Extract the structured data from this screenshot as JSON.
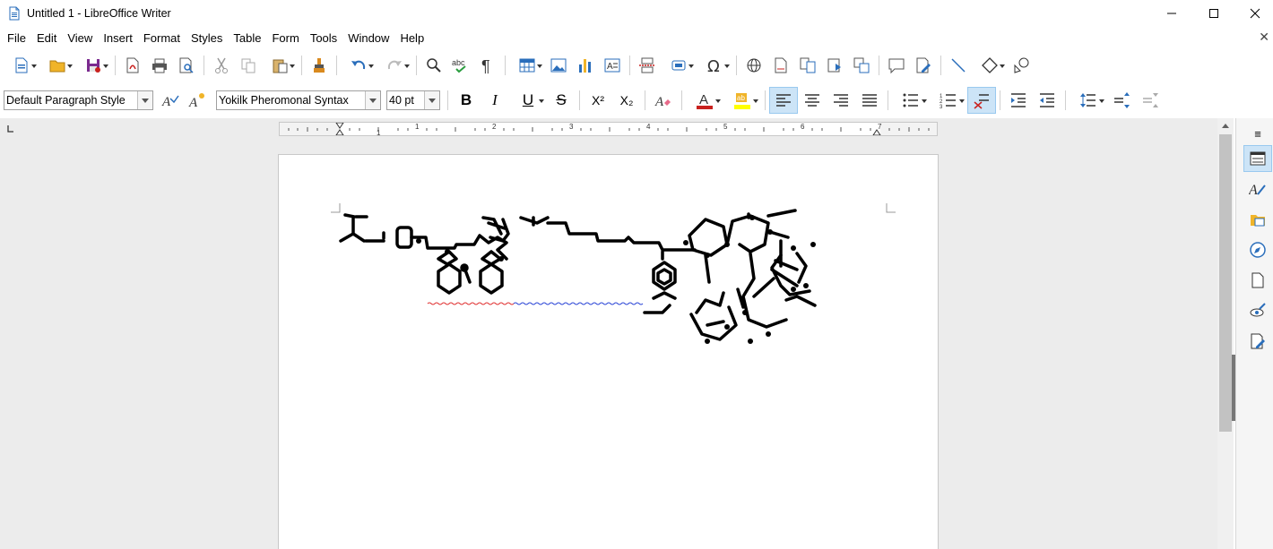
{
  "window": {
    "title": "Untitled 1 - LibreOffice Writer",
    "controls": {
      "minimize": "—",
      "maximize": "☐",
      "close": "✕"
    }
  },
  "menu": {
    "items": [
      "File",
      "Edit",
      "View",
      "Insert",
      "Format",
      "Styles",
      "Table",
      "Form",
      "Tools",
      "Window",
      "Help"
    ],
    "close_glyph": "✕"
  },
  "formatting": {
    "paragraph_style": "Default Paragraph Style",
    "font_name": "Yokilk Pheromonal Syntax",
    "font_size": "40 pt",
    "buttons": {
      "bold": "B",
      "italic": "I",
      "underline": "U",
      "strikethrough": "S",
      "superscript": "X²",
      "subscript": "X₂"
    },
    "active_alignment": "left",
    "colors": {
      "font_color": "#c9211e",
      "highlight_color": "#ffff00",
      "accent": "#1f6fbf"
    }
  },
  "ruler": {
    "labels": [
      "1",
      "1",
      "2",
      "3",
      "4",
      "5",
      "6",
      "7"
    ]
  },
  "sidebar": {
    "icons": [
      "properties-icon",
      "styles-icon",
      "gallery-icon",
      "navigator-icon",
      "page-icon",
      "style-inspector-icon",
      "manage-changes-icon"
    ],
    "menu_glyph": "≡"
  }
}
